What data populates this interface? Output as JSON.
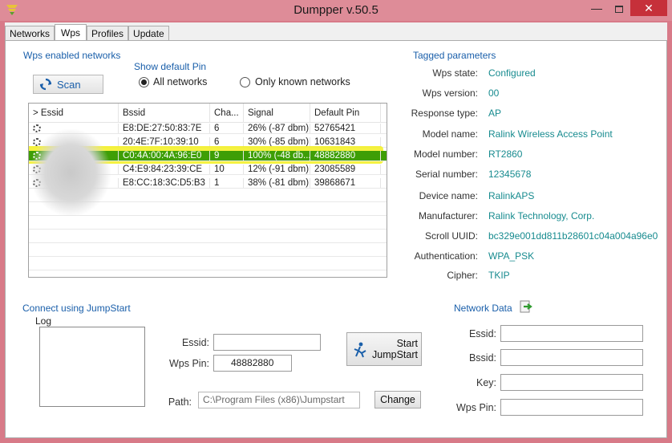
{
  "window": {
    "title": "Dumpper v.50.5",
    "min_glyph": "—",
    "close_glyph": "✕"
  },
  "tabs": [
    {
      "label": "Networks"
    },
    {
      "label": "Wps"
    },
    {
      "label": "Profiles"
    },
    {
      "label": "Update"
    }
  ],
  "wps": {
    "section_title": "Wps enabled networks",
    "scan_label": "Scan",
    "show_default_pin": "Show default Pin",
    "radio_all": "All networks",
    "radio_known": "Only known networks",
    "selected_filter": "All networks",
    "table": {
      "headers": [
        "> Essid",
        "Bssid",
        "Cha...",
        "Signal",
        "Default Pin"
      ],
      "rows": [
        {
          "bssid": "E8:DE:27:50:83:7E",
          "channel": "6",
          "signal": "26% (-87 dbm)",
          "pin": "52765421"
        },
        {
          "bssid": "20:4E:7F:10:39:10",
          "channel": "6",
          "signal": "30% (-85 dbm)",
          "pin": "10631843"
        },
        {
          "bssid": "C0:4A:00:4A:96:E0",
          "channel": "9",
          "signal": "100% (-48 db...",
          "pin": "48882880"
        },
        {
          "bssid": "C4:E9:84:23:39:CE",
          "channel": "10",
          "signal": "12% (-91 dbm)",
          "pin": "23085589"
        },
        {
          "bssid": "E8:CC:18:3C:D5:B3",
          "channel": "1",
          "signal": "38% (-81 dbm)",
          "pin": "39868671"
        }
      ],
      "selected_index": 2
    }
  },
  "tagged": {
    "title": "Tagged parameters",
    "params": [
      {
        "label": "Wps state:",
        "value": "Configured"
      },
      {
        "label": "Wps version:",
        "value": "00"
      },
      {
        "label": "Response type:",
        "value": "AP"
      },
      {
        "label": "Model name:",
        "value": "Ralink Wireless Access Point"
      },
      {
        "label": "Model number:",
        "value": "RT2860"
      },
      {
        "label": "Serial number:",
        "value": "12345678"
      },
      {
        "label": "Device name:",
        "value": "RalinkAPS"
      },
      {
        "label": "Manufacturer:",
        "value": "Ralink Technology, Corp."
      },
      {
        "label": "Scroll UUID:",
        "value": "bc329e001dd811b28601c04a004a96e0"
      },
      {
        "label": "Authentication:",
        "value": "WPA_PSK"
      },
      {
        "label": "Cipher:",
        "value": "TKIP"
      }
    ]
  },
  "jumpstart": {
    "title": "Connect using JumpStart",
    "log_label": "Log",
    "essid_label": "Essid:",
    "essid_value": "",
    "wps_pin_label": "Wps Pin:",
    "wps_pin_value": "48882880",
    "start_line1": "Start",
    "start_line2": "JumpStart",
    "path_label": "Path:",
    "path_value": "C:\\Program Files (x86)\\Jumpstart",
    "change_label": "Change"
  },
  "network_data": {
    "title": "Network Data",
    "fields": [
      {
        "label": "Essid:",
        "value": ""
      },
      {
        "label": "Bssid:",
        "value": ""
      },
      {
        "label": "Key:",
        "value": ""
      },
      {
        "label": "Wps Pin:",
        "value": ""
      }
    ]
  },
  "colors": {
    "frame": "#de8c98",
    "accent_blue": "#1a5faa",
    "value_teal": "#178b8f",
    "selected_row": "#3e9e06",
    "highlight": "#f3f01e",
    "close_button": "#c6303a"
  }
}
